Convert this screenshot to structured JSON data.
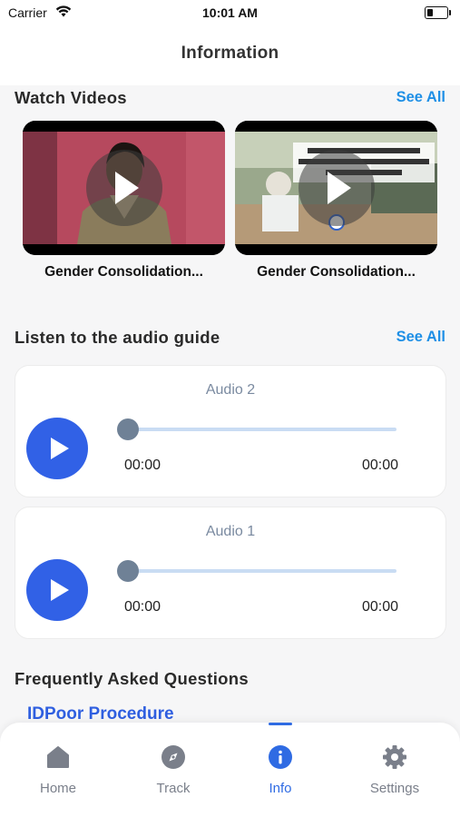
{
  "status_bar": {
    "carrier": "Carrier",
    "time": "10:01 AM"
  },
  "header": {
    "title": "Information"
  },
  "videos": {
    "section_title": "Watch Videos",
    "see_all": "See All",
    "items": [
      {
        "title": "Gender Consolidation..."
      },
      {
        "title": "Gender Consolidation..."
      }
    ]
  },
  "audio": {
    "section_title": "Listen to the audio guide",
    "see_all": "See All",
    "items": [
      {
        "title": "Audio 2",
        "current_time": "00:00",
        "duration": "00:00",
        "progress": 0
      },
      {
        "title": "Audio 1",
        "current_time": "00:00",
        "duration": "00:00",
        "progress": 0
      }
    ]
  },
  "faq": {
    "section_title": "Frequently Asked Questions",
    "first_item": "IDPoor Procedure"
  },
  "tabbar": {
    "active": "Info",
    "items": [
      {
        "label": "Home",
        "icon": "home-icon"
      },
      {
        "label": "Track",
        "icon": "compass-icon"
      },
      {
        "label": "Info",
        "icon": "info-icon"
      },
      {
        "label": "Settings",
        "icon": "gear-icon"
      }
    ]
  },
  "colors": {
    "accent": "#3161e6",
    "link": "#1e8fe6",
    "tab_active": "#2f6be3",
    "tab_inactive": "#7a7f8a"
  }
}
